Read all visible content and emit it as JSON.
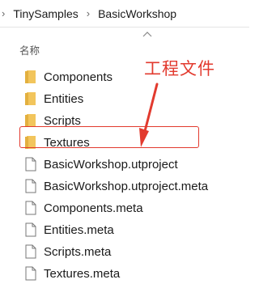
{
  "breadcrumb": {
    "items": [
      "TinySamples",
      "BasicWorkshop"
    ]
  },
  "list": {
    "column_header": "名称",
    "items": [
      {
        "name": "Components",
        "type": "folder"
      },
      {
        "name": "Entities",
        "type": "folder"
      },
      {
        "name": "Scripts",
        "type": "folder"
      },
      {
        "name": "Textures",
        "type": "folder"
      },
      {
        "name": "BasicWorkshop.utproject",
        "type": "file"
      },
      {
        "name": "BasicWorkshop.utproject.meta",
        "type": "file"
      },
      {
        "name": "Components.meta",
        "type": "file"
      },
      {
        "name": "Entities.meta",
        "type": "file"
      },
      {
        "name": "Scripts.meta",
        "type": "file"
      },
      {
        "name": "Textures.meta",
        "type": "file"
      }
    ]
  },
  "annotation": {
    "text": "工程文件",
    "color": "#e23a2e"
  },
  "colors": {
    "folder": "#f2c55c",
    "highlight": "#e23a2e"
  },
  "icons": {
    "breadcrumb_separator": "chevron-right-icon",
    "sort": "chevron-up-icon",
    "folder": "folder-icon",
    "file": "file-icon"
  }
}
